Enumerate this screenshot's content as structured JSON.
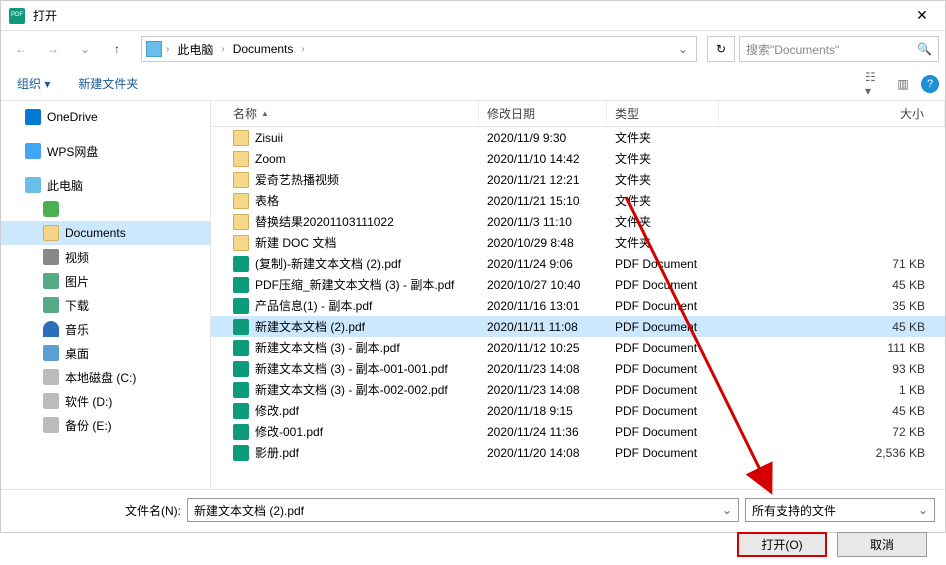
{
  "title": "打开",
  "breadcrumb": {
    "root": "此电脑",
    "folder": "Documents"
  },
  "search_placeholder": "搜索\"Documents\"",
  "toolbar": {
    "organize": "组织",
    "newfolder": "新建文件夹"
  },
  "columns": {
    "name": "名称",
    "date": "修改日期",
    "type": "类型",
    "size": "大小"
  },
  "sidebar": {
    "onedrive": "OneDrive",
    "wps": "WPS网盘",
    "pc": "此电脑",
    "documents": "Documents",
    "video": "视频",
    "pictures": "图片",
    "downloads": "下载",
    "music": "音乐",
    "desktop": "桌面",
    "diskc": "本地磁盘 (C:)",
    "diskd": "软件 (D:)",
    "diske": "备份 (E:)"
  },
  "type_folder": "文件夹",
  "type_pdf": "PDF Document",
  "files": [
    {
      "icon": "folder",
      "name": "Zisuii",
      "date": "2020/11/9 9:30",
      "type": "文件夹",
      "size": ""
    },
    {
      "icon": "folder",
      "name": "Zoom",
      "date": "2020/11/10 14:42",
      "type": "文件夹",
      "size": ""
    },
    {
      "icon": "folder",
      "name": "爱奇艺热播视频",
      "date": "2020/11/21 12:21",
      "type": "文件夹",
      "size": ""
    },
    {
      "icon": "folder",
      "name": "表格",
      "date": "2020/11/21 15:10",
      "type": "文件夹",
      "size": ""
    },
    {
      "icon": "folder",
      "name": "替换结果20201103111022",
      "date": "2020/11/3 11:10",
      "type": "文件夹",
      "size": ""
    },
    {
      "icon": "folder",
      "name": "新建 DOC 文档",
      "date": "2020/10/29 8:48",
      "type": "文件夹",
      "size": ""
    },
    {
      "icon": "pdf",
      "name": "(复制)-新建文本文档 (2).pdf",
      "date": "2020/11/24 9:06",
      "type": "PDF Document",
      "size": "71 KB"
    },
    {
      "icon": "pdf",
      "name": "PDF压缩_新建文本文档 (3) - 副本.pdf",
      "date": "2020/10/27 10:40",
      "type": "PDF Document",
      "size": "45 KB"
    },
    {
      "icon": "pdf",
      "name": "产品信息(1) - 副本.pdf",
      "date": "2020/11/16 13:01",
      "type": "PDF Document",
      "size": "35 KB"
    },
    {
      "icon": "pdf",
      "name": "新建文本文档 (2).pdf",
      "date": "2020/11/11 11:08",
      "type": "PDF Document",
      "size": "45 KB",
      "selected": true
    },
    {
      "icon": "pdf",
      "name": "新建文本文档 (3) - 副本.pdf",
      "date": "2020/11/12 10:25",
      "type": "PDF Document",
      "size": "111 KB"
    },
    {
      "icon": "pdf",
      "name": "新建文本文档 (3) - 副本-001-001.pdf",
      "date": "2020/11/23 14:08",
      "type": "PDF Document",
      "size": "93 KB"
    },
    {
      "icon": "pdf",
      "name": "新建文本文档 (3) - 副本-002-002.pdf",
      "date": "2020/11/23 14:08",
      "type": "PDF Document",
      "size": "1 KB"
    },
    {
      "icon": "pdf",
      "name": "修改.pdf",
      "date": "2020/11/18 9:15",
      "type": "PDF Document",
      "size": "45 KB"
    },
    {
      "icon": "pdf",
      "name": "修改-001.pdf",
      "date": "2020/11/24 11:36",
      "type": "PDF Document",
      "size": "72 KB"
    },
    {
      "icon": "pdf",
      "name": "影册.pdf",
      "date": "2020/11/20 14:08",
      "type": "PDF Document",
      "size": "2,536 KB"
    }
  ],
  "filename_label": "文件名(N):",
  "filename_value": "新建文本文档 (2).pdf",
  "filter": "所有支持的文件",
  "open_btn": "打开(O)",
  "cancel_btn": "取消"
}
